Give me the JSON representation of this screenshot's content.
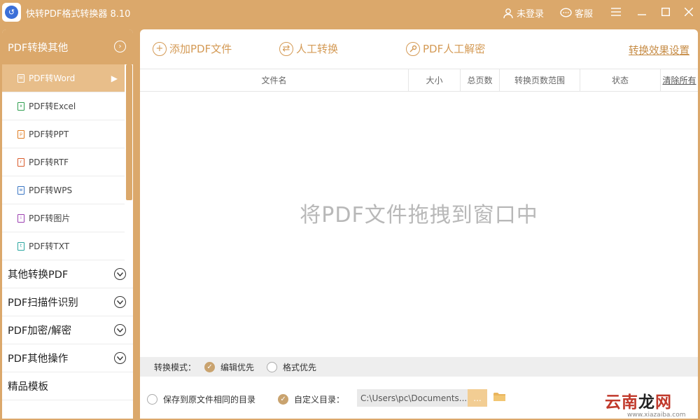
{
  "app": {
    "title": "快转PDF格式转换器 8.10",
    "login_label": "未登录",
    "service_label": "客服"
  },
  "sidebar": {
    "active_category": "PDF转换其他",
    "sub_items": [
      {
        "label": "PDF转Word",
        "icon": "word-file-icon",
        "color": "#4a7bd0"
      },
      {
        "label": "PDF转Excel",
        "icon": "excel-file-icon",
        "color": "#2e9e4f"
      },
      {
        "label": "PDF转PPT",
        "icon": "ppt-file-icon",
        "color": "#e07b1f"
      },
      {
        "label": "PDF转RTF",
        "icon": "rtf-file-icon",
        "color": "#d95a2a"
      },
      {
        "label": "PDF转WPS",
        "icon": "wps-file-icon",
        "color": "#3a76c4"
      },
      {
        "label": "PDF转图片",
        "icon": "image-file-icon",
        "color": "#9b3fb0"
      },
      {
        "label": "PDF转TXT",
        "icon": "txt-file-icon",
        "color": "#2aa6a0"
      }
    ],
    "categories": [
      "其他转换PDF",
      "PDF扫描件识别",
      "PDF加密/解密",
      "PDF其他操作",
      "精品模板"
    ]
  },
  "toolbar": {
    "add_file": "添加PDF文件",
    "manual_convert": "人工转换",
    "manual_decrypt": "PDF人工解密",
    "effect_settings": "转换效果设置"
  },
  "table": {
    "headers": [
      "文件名",
      "大小",
      "总页数",
      "转换页数范围",
      "状态"
    ],
    "clear_all": "清除所有"
  },
  "drop_hint": "将PDF文件拖拽到窗口中",
  "mode": {
    "label": "转换模式：",
    "options": [
      "编辑优先",
      "格式优先"
    ],
    "selected": "编辑优先"
  },
  "output": {
    "same_dir_label": "保存到原文件相同的目录",
    "custom_dir_label": "自定义目录：",
    "path": "C:\\Users\\pc\\Documents...",
    "browse_label": "..."
  },
  "watermark": {
    "text_left": "云南",
    "text_mid": "龙",
    "text_right": "网",
    "url": "www.xiazaiba.com"
  },
  "colors": {
    "accent": "#dba86b",
    "link": "#c68b44"
  }
}
